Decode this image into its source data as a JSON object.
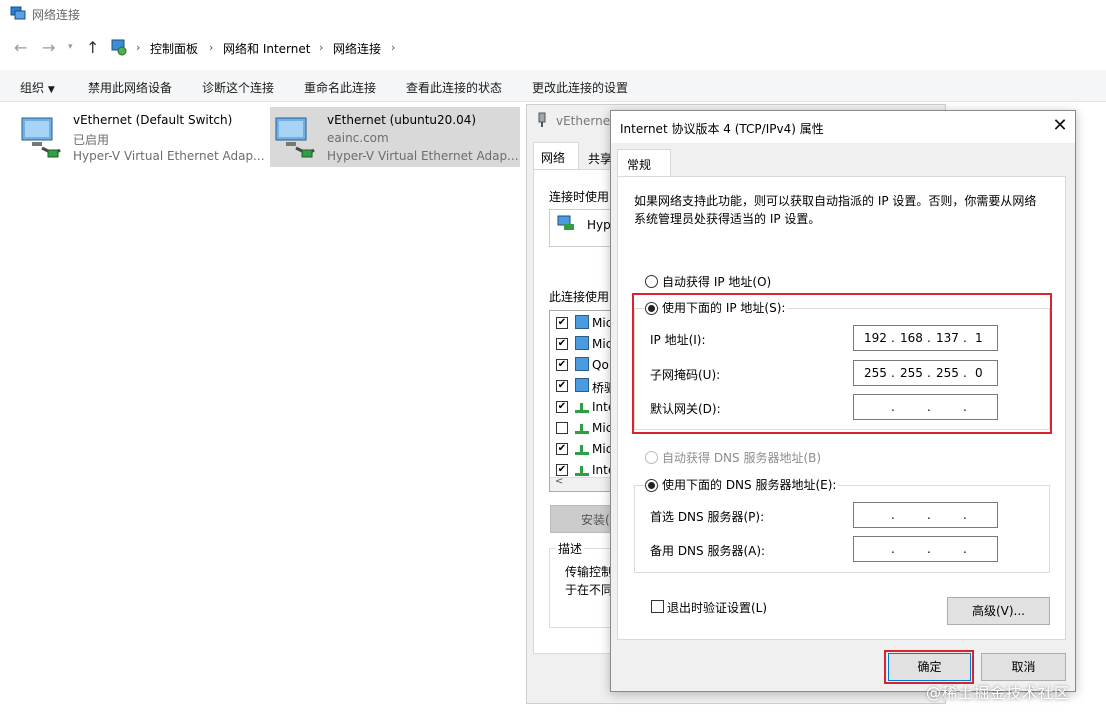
{
  "window": {
    "title": "网络连接"
  },
  "breadcrumb": [
    "控制面板",
    "网络和 Internet",
    "网络连接"
  ],
  "toolbar": {
    "organize": "组织",
    "items": [
      "禁用此网络设备",
      "诊断这个连接",
      "重命名此连接",
      "查看此连接的状态",
      "更改此连接的设置"
    ]
  },
  "connections": [
    {
      "name": "vEthernet (Default Switch)",
      "status": "已启用",
      "device": "Hyper-V Virtual Ethernet Adap..."
    },
    {
      "name": "vEthernet (ubuntu20.04)",
      "status": "eainc.com",
      "device": "Hyper-V Virtual Ethernet Adap..."
    }
  ],
  "props": {
    "title": "vEthernet",
    "tabs": [
      "网络",
      "共享"
    ],
    "connect_using": "连接时使用",
    "adapter": "Hyp",
    "uses_items": "此连接使用",
    "list": [
      {
        "text": "Mic",
        "checked": true
      },
      {
        "text": "Mic",
        "checked": true
      },
      {
        "text": "Qo",
        "checked": true
      },
      {
        "text": "桥驱",
        "checked": true
      },
      {
        "text": "Inte",
        "checked": true
      },
      {
        "text": "Mic",
        "checked": false
      },
      {
        "text": "Mic",
        "checked": true
      },
      {
        "text": "Inte",
        "checked": true
      }
    ],
    "install": "安装(",
    "desc_title": "描述",
    "desc_line1": "传输控制",
    "desc_line2": "于在不同"
  },
  "dialog": {
    "title": "Internet 协议版本 4 (TCP/IPv4) 属性",
    "tab": "常规",
    "description": "如果网络支持此功能，则可以获取自动指派的 IP 设置。否则，你需要从网络系统管理员处获得适当的 IP 设置。",
    "auto_ip": "自动获得 IP 地址(O)",
    "manual_ip": "使用下面的 IP 地址(S):",
    "ip_label": "IP 地址(I):",
    "ip_value": [
      "192",
      "168",
      "137",
      "1"
    ],
    "mask_label": "子网掩码(U):",
    "mask_value": [
      "255",
      "255",
      "255",
      "0"
    ],
    "gateway_label": "默认网关(D):",
    "auto_dns": "自动获得 DNS 服务器地址(B)",
    "manual_dns": "使用下面的 DNS 服务器地址(E):",
    "dns1_label": "首选 DNS 服务器(P):",
    "dns2_label": "备用 DNS 服务器(A):",
    "validate": "退出时验证设置(L)",
    "advanced": "高级(V)...",
    "ok": "确定",
    "cancel": "取消"
  },
  "watermark": "@稀土掘金技术社区",
  "colors": {
    "highlight": "#d9232d",
    "selected": "#d9d9d9"
  }
}
